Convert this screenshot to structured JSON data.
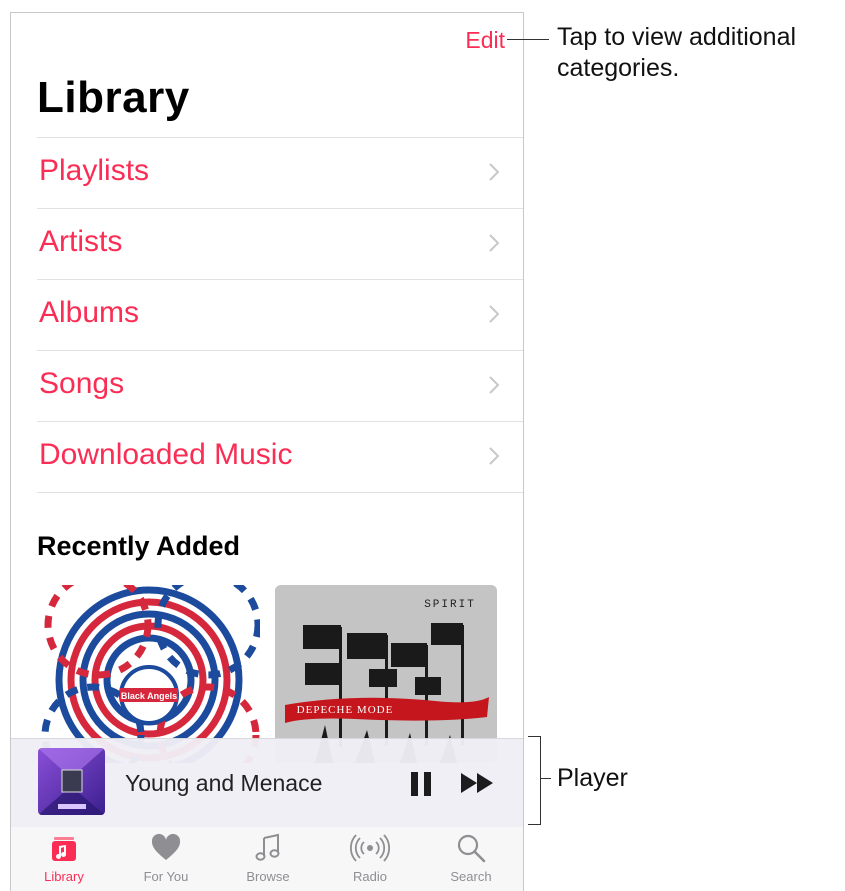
{
  "header": {
    "edit_label": "Edit",
    "title": "Library"
  },
  "menu": {
    "items": [
      {
        "label": "Playlists"
      },
      {
        "label": "Artists"
      },
      {
        "label": "Albums"
      },
      {
        "label": "Songs"
      },
      {
        "label": "Downloaded Music"
      }
    ]
  },
  "recently_added": {
    "title": "Recently Added",
    "albums": [
      {
        "art_text": "Black Angels"
      },
      {
        "art_text_top": "SPIRIT",
        "art_text_band": "DEPECHE MODE"
      }
    ]
  },
  "player": {
    "track": "Young and Menace"
  },
  "tabbar": {
    "tabs": [
      {
        "label": "Library",
        "icon": "library-icon",
        "active": true
      },
      {
        "label": "For You",
        "icon": "heart-icon",
        "active": false
      },
      {
        "label": "Browse",
        "icon": "music-note-icon",
        "active": false
      },
      {
        "label": "Radio",
        "icon": "radio-icon",
        "active": false
      },
      {
        "label": "Search",
        "icon": "search-icon",
        "active": false
      }
    ]
  },
  "callouts": {
    "edit": "Tap to view additional categories.",
    "player": "Player"
  },
  "colors": {
    "accent": "#fa2d55",
    "inactive": "#8e8e93"
  }
}
